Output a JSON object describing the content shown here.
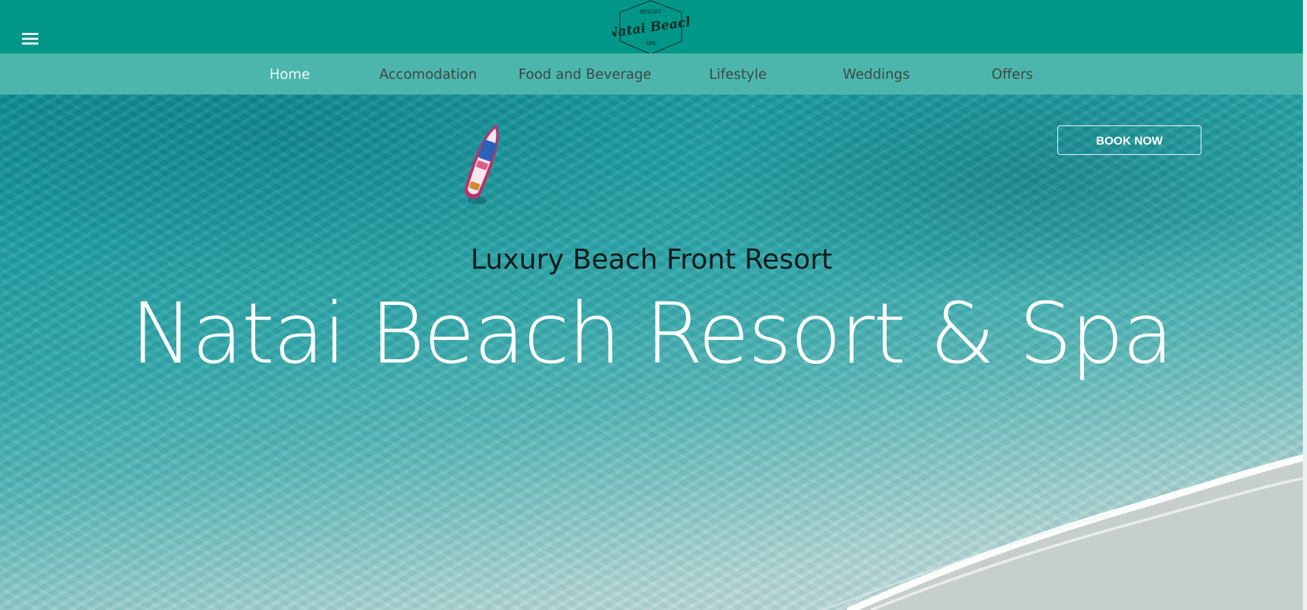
{
  "header": {
    "logo": {
      "top_text": "· RESORT ·",
      "main_text": "Natai Beach",
      "bottom_text": "· SPA ·"
    },
    "menu_icon": "hamburger-menu-icon"
  },
  "nav": {
    "items": [
      {
        "label": "Home",
        "active": true
      },
      {
        "label": "Accomodation",
        "active": false
      },
      {
        "label": "Food and Beverage",
        "active": false
      },
      {
        "label": "Lifestyle",
        "active": false
      },
      {
        "label": "Weddings",
        "active": false
      },
      {
        "label": "Offers",
        "active": false
      }
    ]
  },
  "hero": {
    "book_button": "BOOK NOW",
    "tagline": "Luxury Beach Front Resort",
    "title": "Natai Beach Resort & Spa"
  },
  "colors": {
    "header_bg": "#009788",
    "nav_bg": "#4db6ac",
    "nav_text": "#3b4a47",
    "nav_active_text": "#eaf7f5",
    "water": "#1f9ea2"
  }
}
